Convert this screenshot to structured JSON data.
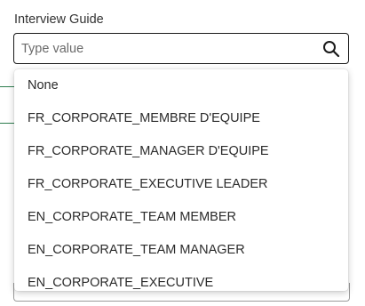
{
  "field": {
    "label": "Interview Guide",
    "placeholder": "Type value",
    "value": ""
  },
  "icons": {
    "search": "search-icon"
  },
  "dropdown": {
    "options": [
      "None",
      "FR_CORPORATE_MEMBRE D'EQUIPE",
      "FR_CORPORATE_MANAGER D'EQUIPE",
      "FR_CORPORATE_EXECUTIVE LEADER",
      "EN_CORPORATE_TEAM MEMBER",
      "EN_CORPORATE_TEAM MANAGER",
      "EN_CORPORATE_EXECUTIVE"
    ]
  },
  "colors": {
    "accent_line": "#2e7d4f",
    "border": "#1a1a1a"
  }
}
